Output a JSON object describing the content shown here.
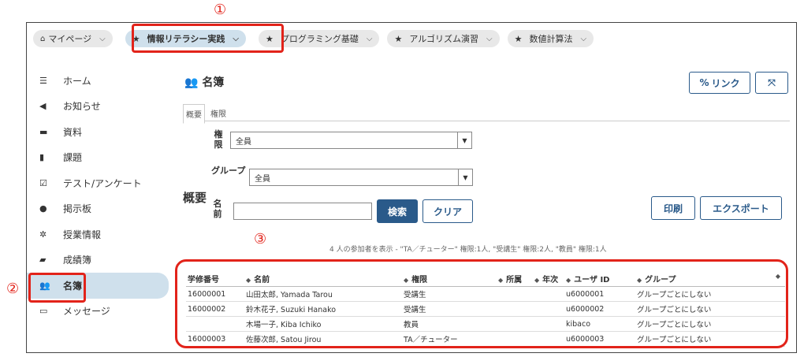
{
  "callouts": {
    "c1": "①",
    "c2": "②",
    "c3": "③"
  },
  "topbar": {
    "tabs": [
      {
        "label": "マイページ"
      },
      {
        "label": "情報リテラシー実践"
      },
      {
        "label": "プログラミング基礎"
      },
      {
        "label": "アルゴリズム演習"
      },
      {
        "label": "数値計算法"
      }
    ]
  },
  "sidebar": {
    "items": [
      {
        "label": "ホーム"
      },
      {
        "label": "お知らせ"
      },
      {
        "label": "資料"
      },
      {
        "label": "課題"
      },
      {
        "label": "テスト/アンケート"
      },
      {
        "label": "掲示板"
      },
      {
        "label": "授業情報"
      },
      {
        "label": "成績簿"
      },
      {
        "label": "名簿"
      },
      {
        "label": "メッセージ"
      }
    ]
  },
  "main": {
    "title": "名簿",
    "link_button": "リンク",
    "subtabs": [
      "概要",
      "権限"
    ],
    "section_label": "概要",
    "filters": {
      "role_label": "権限",
      "role_value": "全員",
      "group_label": "グループ",
      "group_value": "全員",
      "name_label": "名前",
      "name_value": "",
      "search_button": "検索",
      "clear_button": "クリア"
    },
    "print_button": "印刷",
    "export_button": "エクスポート",
    "summary": "4 人の参加者を表示 - \"TA／チューター\" 権限:1人, \"受講生\" 権限:2人, \"教員\" 権限:1人"
  },
  "table": {
    "headers": [
      "学修番号",
      "名前",
      "権限",
      "所属",
      "年次",
      "ユーザ ID",
      "グループ"
    ],
    "rows": [
      [
        "16000001",
        "山田太郎, Yamada Tarou",
        "受講生",
        "",
        "",
        "u6000001",
        "グループごとにしない"
      ],
      [
        "16000002",
        "鈴木花子, Suzuki Hanako",
        "受講生",
        "",
        "",
        "u6000002",
        "グループごとにしない"
      ],
      [
        "",
        "木場一子, Kiba Ichiko",
        "教員",
        "",
        "",
        "kibaco",
        "グループごとにしない"
      ],
      [
        "16000003",
        "佐藤次郎, Satou Jirou",
        "TA／チューター",
        "",
        "",
        "u6000003",
        "グループごとにしない"
      ]
    ]
  }
}
